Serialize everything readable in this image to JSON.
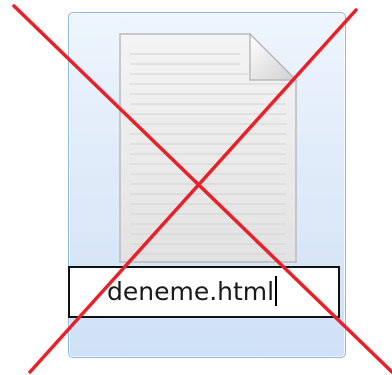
{
  "file": {
    "name": "deneme.html",
    "icon": "blank-document-icon",
    "state": "renaming"
  },
  "colors": {
    "selection_border": "#8fb8e6",
    "selection_fill": "#dce9f8",
    "cross": "#e8202a",
    "field_border": "#111111"
  },
  "overlay": {
    "icon": "red-x-cross"
  }
}
